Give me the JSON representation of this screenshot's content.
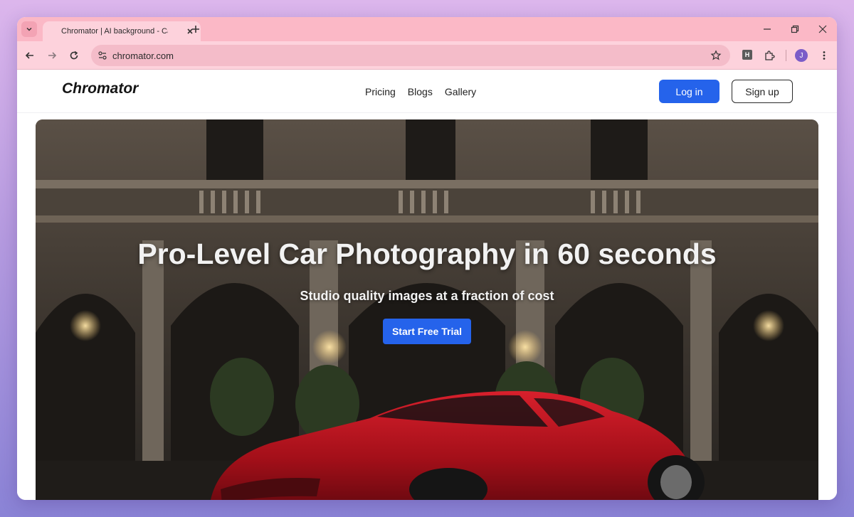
{
  "browser": {
    "tab_title": "Chromator | AI background - Car",
    "url": "chromator.com",
    "profile_initial": "J",
    "extension_label": "H"
  },
  "site": {
    "logo": "Chromator",
    "nav": [
      "Pricing",
      "Blogs",
      "Gallery"
    ],
    "login_label": "Log in",
    "signup_label": "Sign up"
  },
  "hero": {
    "title": "Pro-Level Car Photography in 60 seconds",
    "subtitle": "Studio quality images at a fraction of cost",
    "cta_label": "Start Free Trial"
  },
  "colors": {
    "accent": "#2563eb",
    "tab_strip": "#fbb8c6",
    "toolbar": "#fdd2dc",
    "car": "#b3121e"
  }
}
